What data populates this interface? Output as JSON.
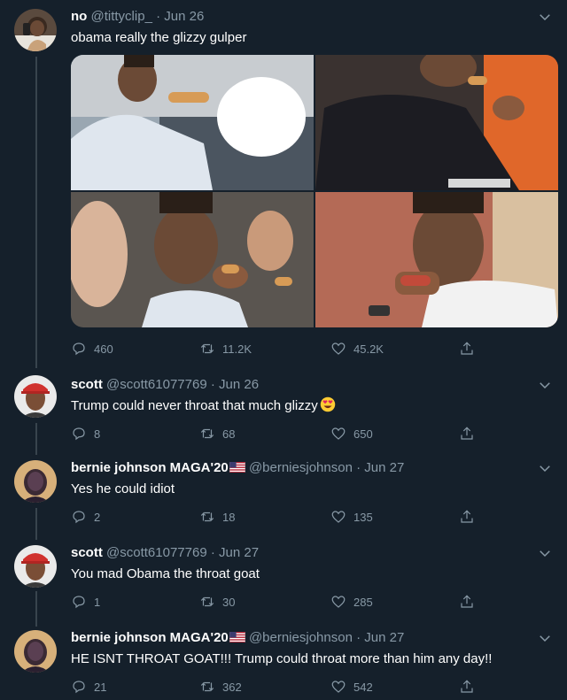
{
  "tweets": [
    {
      "name": "no",
      "handle": "@tittyclip_",
      "dot": "·",
      "date": "Jun 26",
      "text": "obama really the glizzy gulper",
      "replies": "460",
      "retweets": "11.2K",
      "likes": "45.2K",
      "has_media": true
    },
    {
      "name": "scott",
      "handle": "@scott61077769",
      "dot": "·",
      "date": "Jun 26",
      "text": "Trump could never throat that much glizzy",
      "replies": "8",
      "retweets": "68",
      "likes": "650"
    },
    {
      "name": "bernie johnson MAGA'20",
      "handle": "@berniesjohnson",
      "dot": "·",
      "date": "Jun 27",
      "text": "Yes he could idiot",
      "replies": "2",
      "retweets": "18",
      "likes": "135"
    },
    {
      "name": "scott",
      "handle": "@scott61077769",
      "dot": "·",
      "date": "Jun 27",
      "text": "You mad Obama the throat goat",
      "replies": "1",
      "retweets": "30",
      "likes": "285"
    },
    {
      "name": "bernie johnson MAGA'20",
      "handle": "@berniesjohnson",
      "dot": "·",
      "date": "Jun 27",
      "text": "HE ISNT THROAT GOAT!!! Trump could throat more than him any day!!",
      "replies": "21",
      "retweets": "362",
      "likes": "542"
    }
  ],
  "icons": {
    "reply": "reply-icon",
    "retweet": "retweet-icon",
    "like": "heart-icon",
    "share": "share-icon",
    "more": "chevron-down-icon",
    "flag": "us-flag-icon",
    "emoji": "heart-eyes-emoji"
  },
  "colors": {
    "background": "#15202b",
    "text": "#ffffff",
    "secondary": "#8899a6",
    "thread_line": "#38444d"
  }
}
